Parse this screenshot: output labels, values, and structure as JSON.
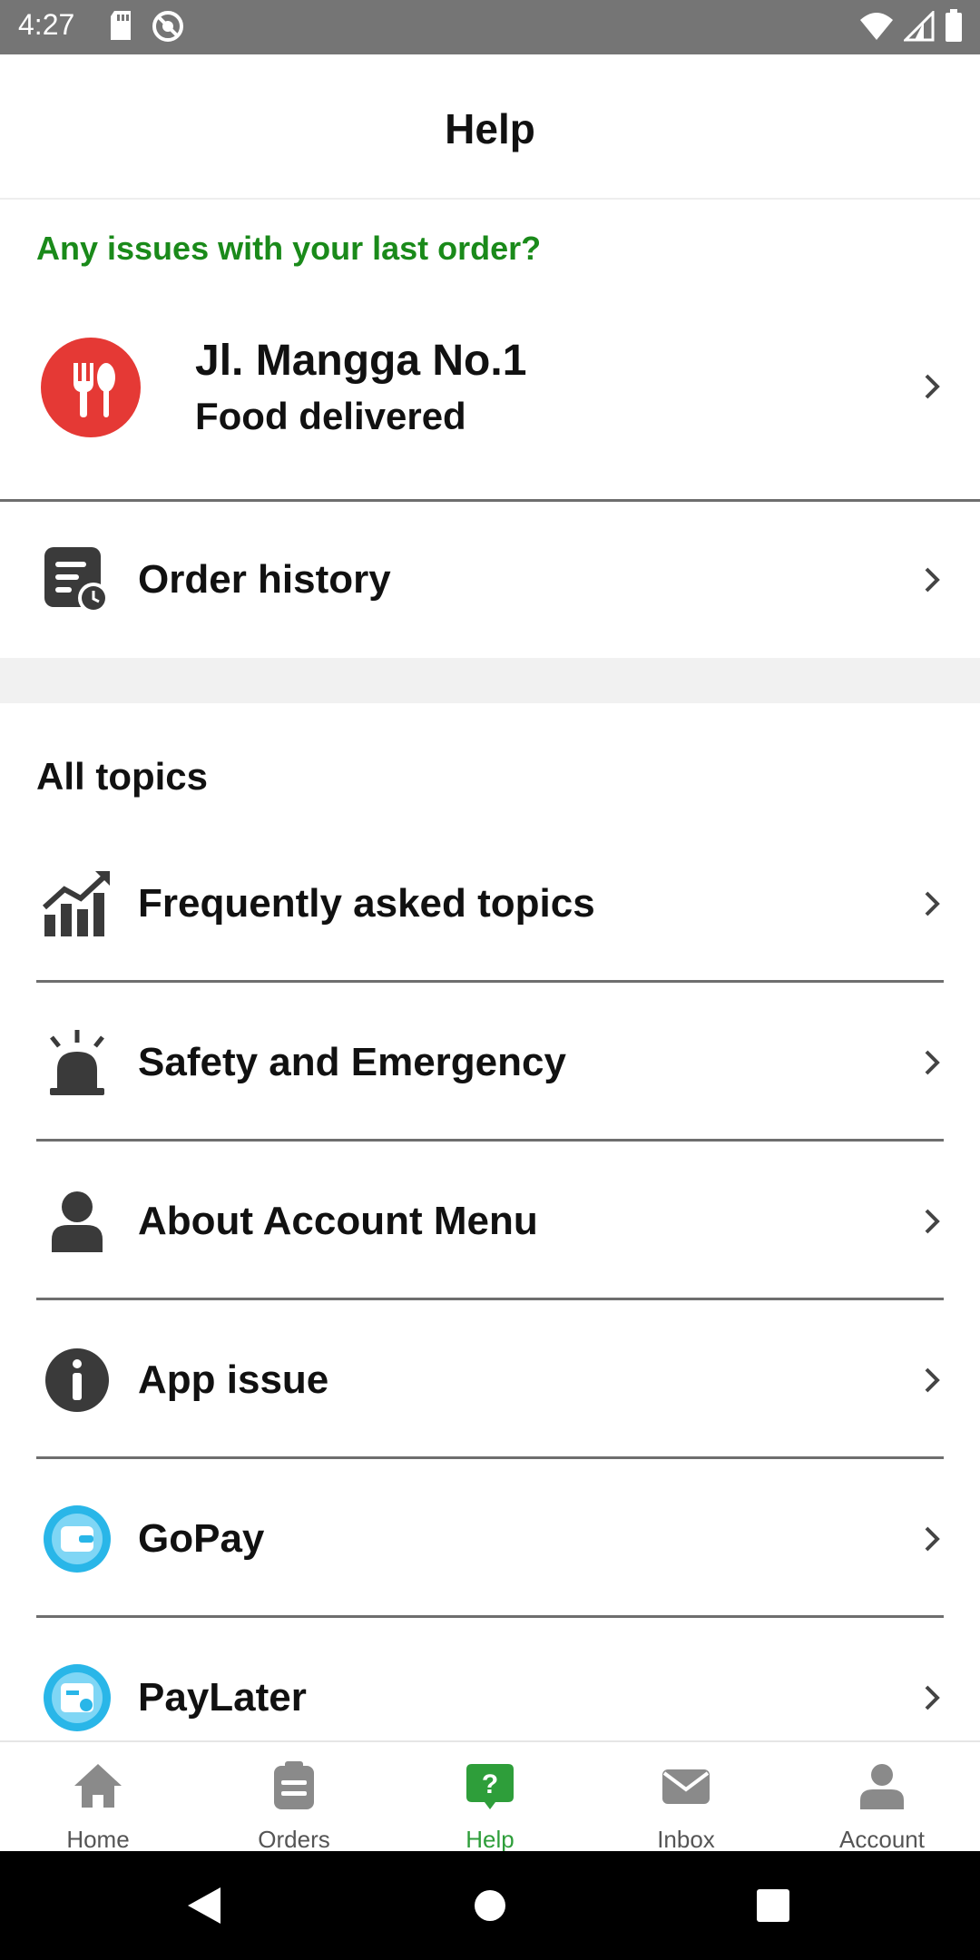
{
  "status_bar": {
    "time": "4:27",
    "left_icons": [
      "sd-card-icon",
      "no-sync-icon"
    ],
    "right_icons": [
      "wifi-icon",
      "signal-icon",
      "battery-icon"
    ]
  },
  "header": {
    "title": "Help"
  },
  "last_order": {
    "prompt": "Any issues with your last order?",
    "address": "Jl. Mangga No.1",
    "status": "Food delivered",
    "badge_color": "#e53935"
  },
  "order_history": {
    "label": "Order history"
  },
  "topics": {
    "title": "All topics",
    "items": [
      {
        "label": "Frequently asked topics",
        "icon": "trending-chart-icon"
      },
      {
        "label": "Safety and Emergency",
        "icon": "siren-icon"
      },
      {
        "label": "About Account Menu",
        "icon": "person-icon"
      },
      {
        "label": "App issue",
        "icon": "info-icon"
      },
      {
        "label": "GoPay",
        "icon": "gopay-wallet-icon"
      },
      {
        "label": "PayLater",
        "icon": "paylater-icon"
      }
    ]
  },
  "bottom_nav": {
    "items": [
      {
        "label": "Home",
        "icon": "home-icon"
      },
      {
        "label": "Orders",
        "icon": "orders-icon"
      },
      {
        "label": "Help",
        "icon": "help-icon",
        "active": true
      },
      {
        "label": "Inbox",
        "icon": "inbox-icon"
      },
      {
        "label": "Account",
        "icon": "account-icon"
      }
    ]
  },
  "colors": {
    "accent_green": "#2e9e3a",
    "prompt_green": "#1a8a1a",
    "food_red": "#e53935",
    "gopay_blue": "#29b6e8",
    "status_bar": "#757575"
  }
}
